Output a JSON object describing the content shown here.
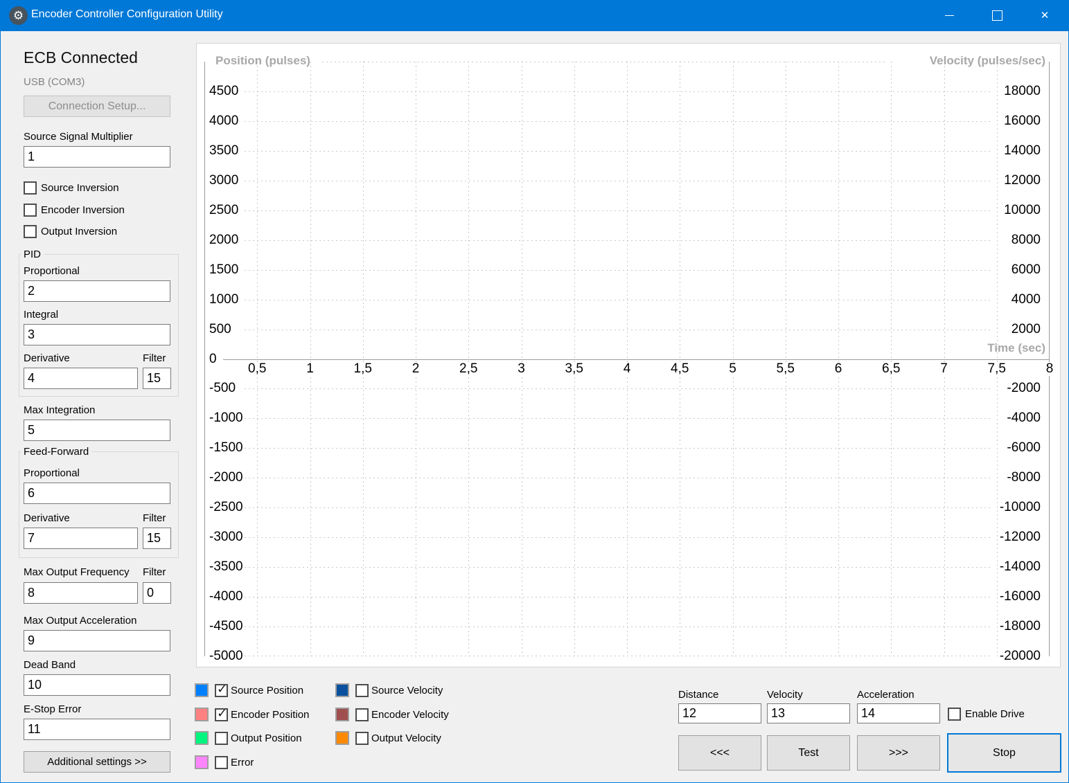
{
  "window": {
    "title": "Encoder Controller Configuration Utility"
  },
  "sidebar": {
    "status_heading": "ECB Connected",
    "connection_info": "USB (COM3)",
    "connection_setup_button": "Connection Setup...",
    "source_signal_multiplier": {
      "label": "Source Signal Multiplier",
      "value": "1"
    },
    "inversion_checkboxes": [
      {
        "label": "Source Inversion",
        "checked": false
      },
      {
        "label": "Encoder Inversion",
        "checked": false
      },
      {
        "label": "Output Inversion",
        "checked": false
      }
    ],
    "pid_group": {
      "title": "PID",
      "proportional": {
        "label": "Proportional",
        "value": "2"
      },
      "integral": {
        "label": "Integral",
        "value": "3"
      },
      "derivative": {
        "label": "Derivative",
        "value": "4"
      },
      "filter": {
        "label": "Filter",
        "value": "15"
      }
    },
    "max_integration": {
      "label": "Max Integration",
      "value": "5"
    },
    "feed_forward_group": {
      "title": "Feed-Forward",
      "proportional": {
        "label": "Proportional",
        "value": "6"
      },
      "derivative": {
        "label": "Derivative",
        "value": "7"
      },
      "filter": {
        "label": "Filter",
        "value": "15"
      }
    },
    "max_output_frequency": {
      "label": "Max Output Frequency",
      "value": "8"
    },
    "max_output_frequency_filter": {
      "label": "Filter",
      "value": "0"
    },
    "max_output_acceleration": {
      "label": "Max Output Acceleration",
      "value": "9"
    },
    "dead_band": {
      "label": "Dead Band",
      "value": "10"
    },
    "e_stop_error": {
      "label": "E-Stop Error",
      "value": "11"
    },
    "additional_settings_button": "Additional settings >>"
  },
  "chart_data": {
    "type": "line",
    "title": "",
    "grid": "dashed",
    "x_axis": {
      "label": "Time (sec)",
      "min": 0,
      "max": 8,
      "tick_step": 0.5,
      "tick_labels": [
        "0,5",
        "1",
        "1,5",
        "2",
        "2,5",
        "3",
        "3,5",
        "4",
        "4,5",
        "5",
        "5,5",
        "6",
        "6,5",
        "7",
        "7,5",
        "8"
      ]
    },
    "left_y_axis": {
      "label": "Position (pulses)",
      "min": -5000,
      "max": 5000,
      "tick_step": 500,
      "tick_labels": [
        "4500",
        "4000",
        "3500",
        "3000",
        "2500",
        "2000",
        "1500",
        "1000",
        "500",
        "0",
        "-500",
        "-1000",
        "-1500",
        "-2000",
        "-2500",
        "-3000",
        "-3500",
        "-4000",
        "-4500",
        "-5000"
      ]
    },
    "right_y_axis": {
      "label": "Velocity (pulses/sec)",
      "min": -20000,
      "max": 20000,
      "tick_step": 2000,
      "tick_labels": [
        "18000",
        "16000",
        "14000",
        "12000",
        "10000",
        "8000",
        "6000",
        "4000",
        "2000",
        "-2000",
        "-4000",
        "-6000",
        "-8000",
        "-10000",
        "-12000",
        "-14000",
        "-16000",
        "-18000",
        "-20000"
      ]
    },
    "series": [
      {
        "name": "Source Position",
        "color": "#0080FF",
        "visible": true,
        "values": []
      },
      {
        "name": "Encoder Position",
        "color": "#FF8080",
        "visible": true,
        "values": []
      },
      {
        "name": "Output Position",
        "color": "#00F57E",
        "visible": false,
        "values": []
      },
      {
        "name": "Error",
        "color": "#FF85FF",
        "visible": false,
        "values": []
      },
      {
        "name": "Source Velocity",
        "color": "#0A509E",
        "visible": false,
        "values": []
      },
      {
        "name": "Encoder Velocity",
        "color": "#A04F4F",
        "visible": false,
        "values": []
      },
      {
        "name": "Output Velocity",
        "color": "#FF8A00",
        "visible": false,
        "values": []
      }
    ]
  },
  "test_controls": {
    "distance": {
      "label": "Distance",
      "value": "12"
    },
    "velocity": {
      "label": "Velocity",
      "value": "13"
    },
    "acceleration": {
      "label": "Acceleration",
      "value": "14"
    },
    "enable_drive": {
      "label": "Enable Drive",
      "checked": false
    },
    "buttons": {
      "reverse": "<<<",
      "test": "Test",
      "forward": ">>>",
      "stop": "Stop"
    }
  }
}
